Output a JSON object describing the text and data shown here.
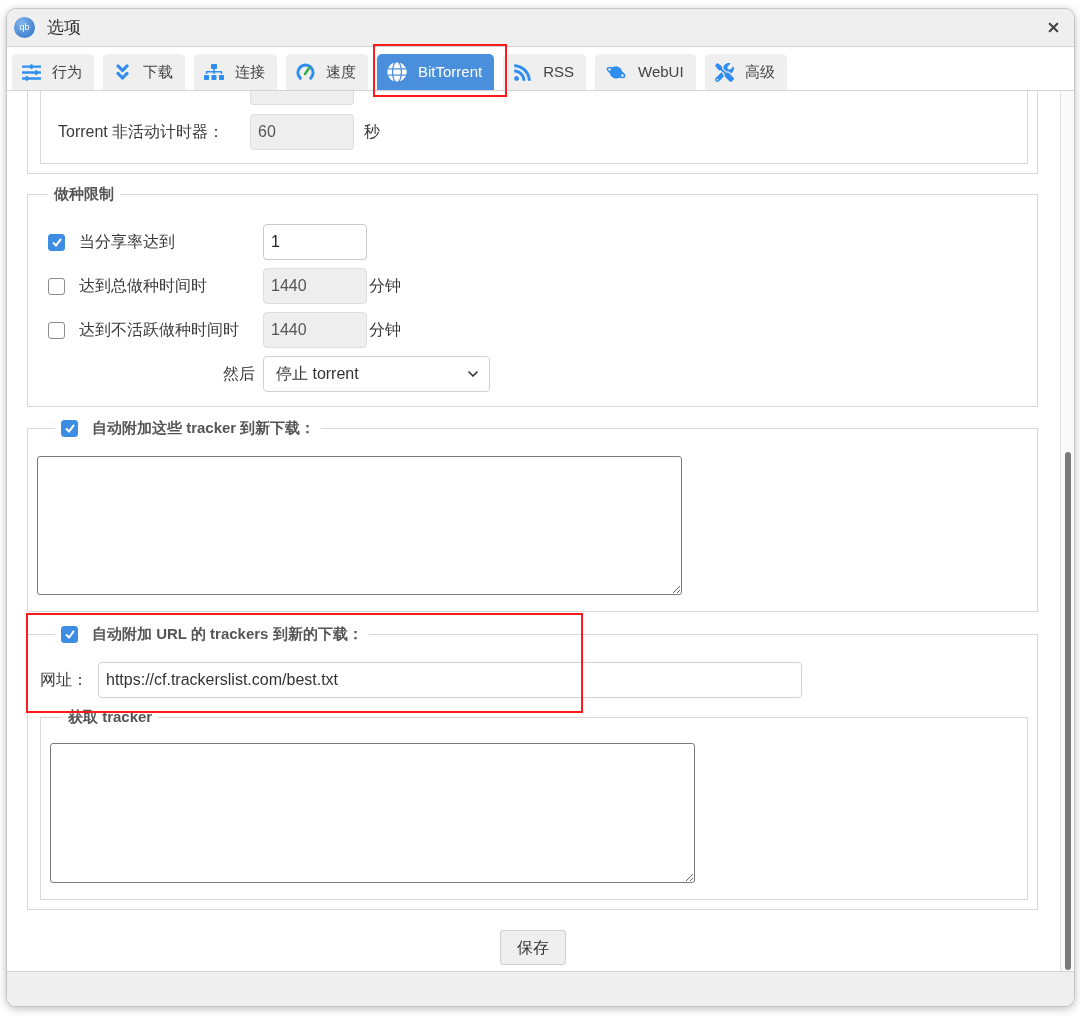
{
  "window": {
    "title": "选项",
    "logo": "qb"
  },
  "tabs": [
    {
      "label": "行为",
      "selected": false
    },
    {
      "label": "下载",
      "selected": false
    },
    {
      "label": "连接",
      "selected": false
    },
    {
      "label": "速度",
      "selected": false
    },
    {
      "label": "BitTorrent",
      "selected": true
    },
    {
      "label": "RSS",
      "selected": false
    },
    {
      "label": "WebUI",
      "selected": false
    },
    {
      "label": "高级",
      "selected": false
    }
  ],
  "queueing": {
    "timer": {
      "label": "Torrent 非活动计时器：",
      "value": "60",
      "unit": "秒",
      "disabled": true
    }
  },
  "seeding_limits": {
    "legend": "做种限制",
    "rows": [
      {
        "label": "当分享率达到",
        "checked": true,
        "value": "1",
        "disabled": false
      },
      {
        "label": "达到总做种时间时",
        "checked": false,
        "value": "1440",
        "unit": "分钟",
        "disabled": true
      },
      {
        "label": "达到不活跃做种时间时",
        "checked": false,
        "value": "1440",
        "unit": "分钟",
        "disabled": true
      }
    ],
    "then": {
      "label": "然后",
      "value": "停止 torrent"
    }
  },
  "add_trackers": {
    "label": "自动附加这些 tracker 到新下载：",
    "checked": true
  },
  "add_trackers_url": {
    "label": "自动附加 URL 的 trackers 到新的下载：",
    "checked": true,
    "url_label": "网址：",
    "url": "https://cf.trackerslist.com/best.txt",
    "fetched": {
      "legend": "获取 tracker"
    }
  },
  "buttons": {
    "save": "保存"
  }
}
